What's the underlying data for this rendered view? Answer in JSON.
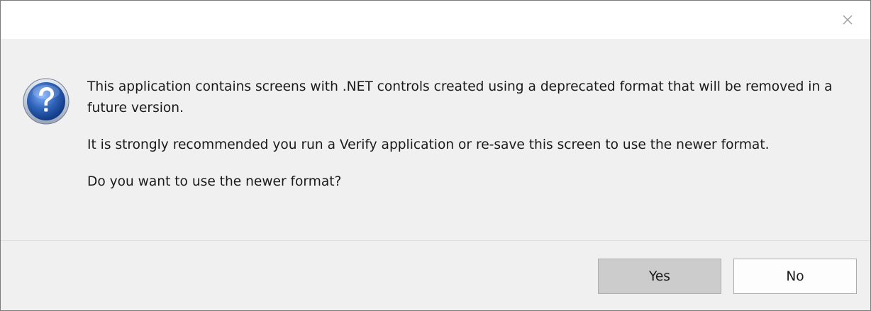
{
  "dialog": {
    "close_icon": "close-icon",
    "icon": "question-icon",
    "message": {
      "line1": "This application contains screens with .NET controls created using a deprecated format that will be removed in a future version.",
      "line2": "It is strongly recommended you run a Verify application or re-save this screen to use the newer format.",
      "line3": "Do you want to use the newer format?"
    },
    "buttons": {
      "yes_label": "Yes",
      "no_label": "No"
    }
  },
  "colors": {
    "dialog_background": "#f0f0f0",
    "titlebar_background": "#ffffff",
    "icon_blue": "#2f63b8",
    "yes_button_background": "#cccccc",
    "no_button_background": "#fdfdfd"
  }
}
